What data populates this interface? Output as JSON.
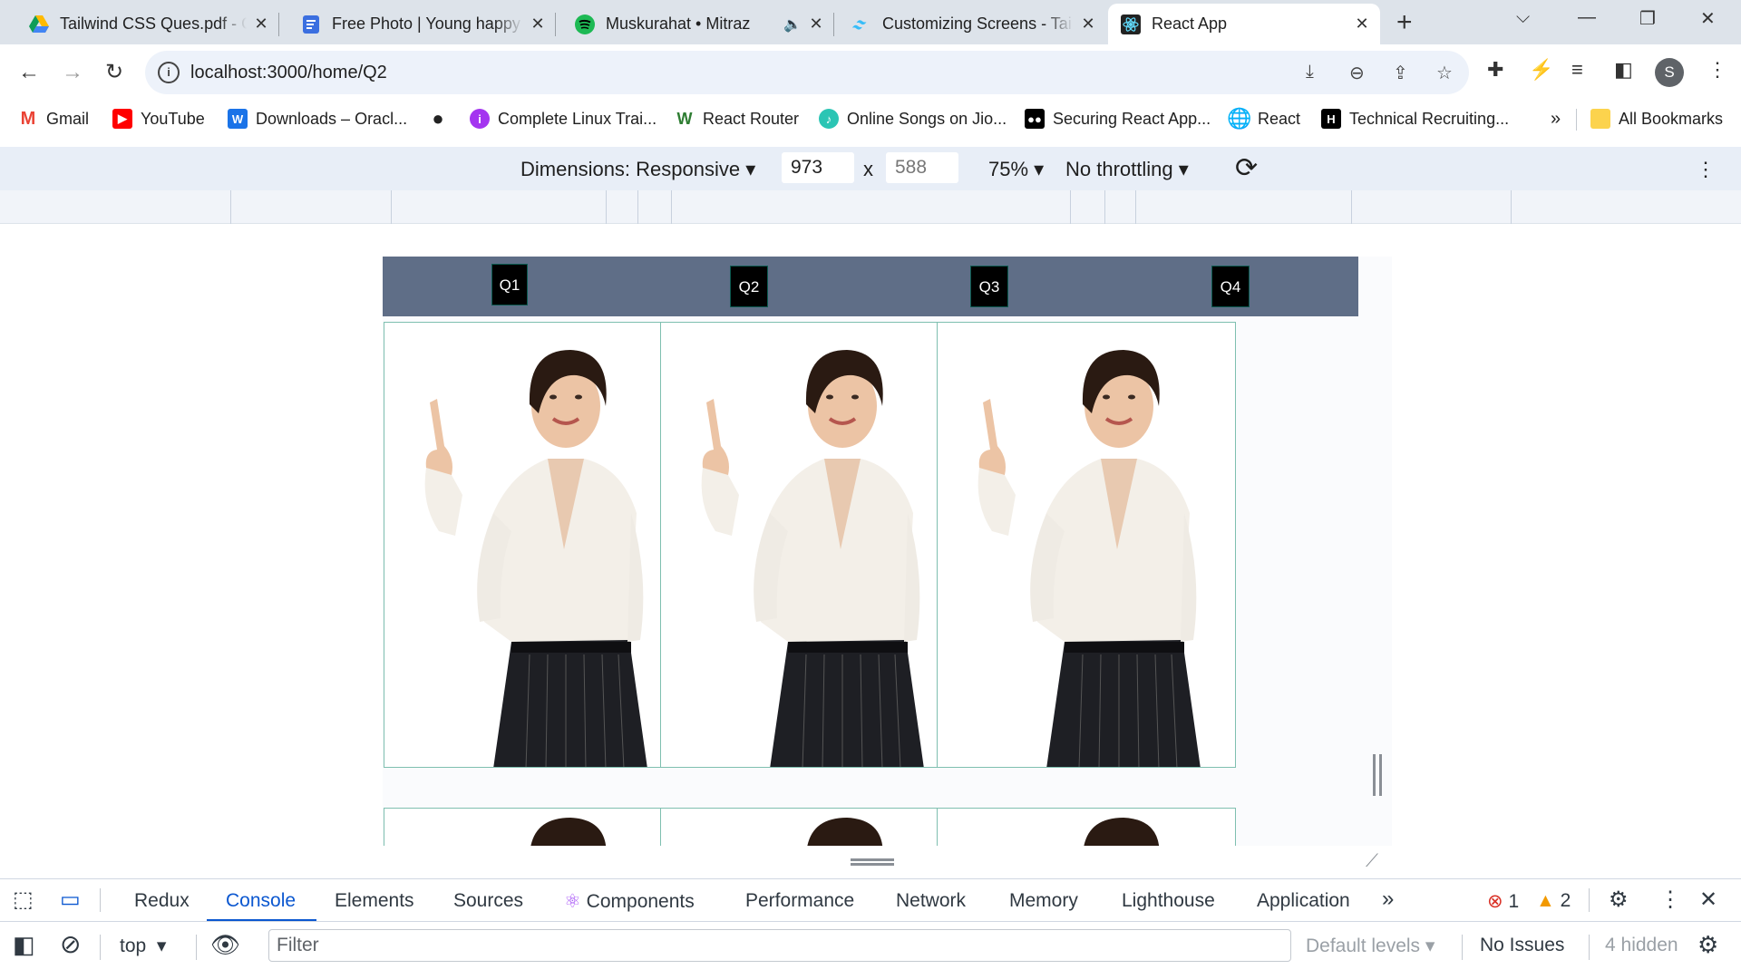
{
  "browser": {
    "tabs": [
      {
        "title": "Tailwind CSS Ques.pdf - G",
        "close": "✕"
      },
      {
        "title": "Free Photo | Young happy",
        "close": "✕"
      },
      {
        "title": "Muskurahat • Mitraz",
        "close": "✕",
        "audio": "🔈"
      },
      {
        "title": "Customizing Screens - Tai",
        "close": "✕"
      },
      {
        "title": "React App",
        "close": "✕",
        "active": true
      }
    ],
    "new_tab": "+",
    "url": "localhost:3000/home/Q2",
    "bookmarks": [
      {
        "label": "Gmail",
        "icon": "gmail-icon"
      },
      {
        "label": "YouTube",
        "icon": "youtube-icon"
      },
      {
        "label": "Downloads – Oracl...",
        "icon": "oracle-icon"
      },
      {
        "label": "",
        "icon": "globe-icon"
      },
      {
        "label": "Complete Linux Trai...",
        "icon": "linux-course-icon"
      },
      {
        "label": "React Router",
        "icon": "react-router-icon"
      },
      {
        "label": "Online Songs on Jio...",
        "icon": "jiosaavn-icon"
      },
      {
        "label": "Securing React App...",
        "icon": "medium-icon"
      },
      {
        "label": "React",
        "icon": "globe-icon"
      },
      {
        "label": "Technical Recruiting...",
        "icon": "hackerearth-icon"
      }
    ],
    "bookmarks_overflow": "»",
    "all_bookmarks": "All Bookmarks",
    "avatar_letter": "S"
  },
  "device_toolbar": {
    "dimensions_label": "Dimensions: Responsive",
    "width": "973",
    "times": "x",
    "height": "588",
    "zoom": "75%",
    "throttling": "No throttling"
  },
  "app": {
    "nav_buttons": [
      "Q1",
      "Q2",
      "Q3",
      "Q4"
    ],
    "cards": [
      {
        "image": "woman-pointing-up-photo"
      },
      {
        "image": "woman-pointing-up-photo"
      },
      {
        "image": "woman-pointing-up-photo"
      }
    ]
  },
  "devtools": {
    "tabs": [
      "Redux",
      "Console",
      "Elements",
      "Sources",
      "Components",
      "Performance",
      "Network",
      "Memory",
      "Lighthouse",
      "Application"
    ],
    "active_tab": "Console",
    "more": "»",
    "errors": "1",
    "warnings": "2",
    "context": "top",
    "filter_placeholder": "Filter",
    "levels": "Default levels",
    "issues": "No Issues",
    "hidden": "4 hidden"
  },
  "colors": {
    "navbar": "#5f6e87",
    "active_tab": "#0b57d0",
    "tabstrip": "#dde3ea"
  }
}
